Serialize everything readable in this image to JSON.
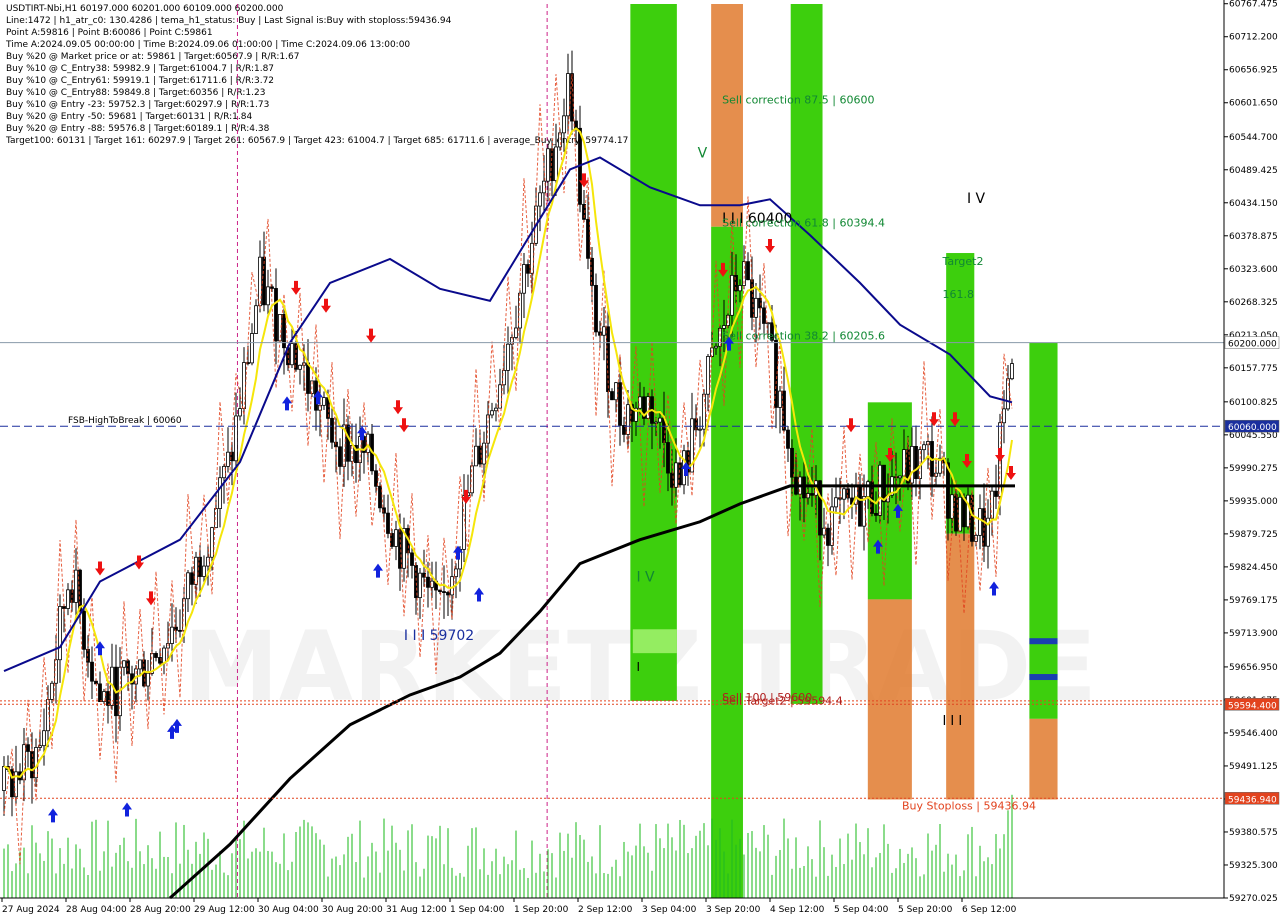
{
  "info_lines": [
    "USDTIRT-Nbi,H1  60197.000 60201.000 60109.000 60200.000",
    "Line:1472  | h1_atr_c0: 130.4286  | tema_h1_status: Buy  | Last Signal is:Buy with stoploss:59436.94",
    "Point A:59816  | Point B:60086  | Point C:59861",
    "Time A:2024.09.05 00:00:00  | Time B:2024.09.06 01:00:00  | Time C:2024.09.06 13:00:00",
    "Buy %20 @ Market price or at: 59861  | Target:60567.9  | R/R:1.67",
    "Buy %10 @ C_Entry38: 59982.9  | Target:61004.7  | R/R:1.87",
    "Buy %10 @ C_Entry61: 59919.1  | Target:61711.6  | R/R:3.72",
    "Buy %10 @ C_Entry88: 59849.8  | Target:60356  | R/R:1.23",
    "Buy %10 @ Entry -23: 59752.3  | Target:60297.9  | R/R:1.73",
    "Buy %20 @ Entry -50: 59681  | Target:60131  | R/R:1.84",
    "Buy %20 @ Entry -88: 59576.8  | Target:60189.1  | R/R:4.38",
    "Target100: 60131  | Target 161: 60297.9  | Target 261: 60567.9  | Target 423: 61004.7  | Target 685: 61711.6  | average_Buy_entry: 59774.17"
  ],
  "watermark": "MARKETZITRADE",
  "colors": {
    "background": "#ffffff",
    "green_zone": "#33cc00",
    "orange_zone": "#e07a2e",
    "tema_line": "#0a0a8c",
    "ma_black": "#000000",
    "yellow_line": "#f5e60a",
    "channel_red": "#e2431e",
    "dashed_blue": "#1a2f9e",
    "volume": "#22bb22",
    "candle": "#000000",
    "buy_arrow": "#1122dd",
    "sell_arrow": "#ee1111"
  },
  "chart_data": {
    "type": "candlestick",
    "symbol": "USDTIRT-Nbi",
    "timeframe": "H1",
    "ylim": [
      59270,
      60767
    ],
    "y_ticks": [
      "60767.475",
      "60712.200",
      "60656.925",
      "60601.650",
      "60544.700",
      "60489.425",
      "60434.150",
      "60378.875",
      "60323.600",
      "60268.325",
      "60213.050",
      "60157.775",
      "60100.825",
      "60045.550",
      "59990.275",
      "59935.000",
      "59879.725",
      "59824.450",
      "59769.175",
      "59713.900",
      "59656.950",
      "59601.675",
      "59546.400",
      "59491.125",
      "59435.850",
      "59380.575",
      "59325.300",
      "59270.025"
    ],
    "x_labels": [
      "27 Aug 2024",
      "28 Aug 04:00",
      "28 Aug 20:00",
      "29 Aug 12:00",
      "30 Aug 04:00",
      "30 Aug 20:00",
      "31 Aug 12:00",
      "1 Sep 04:00",
      "1 Sep 20:00",
      "2 Sep 12:00",
      "3 Sep 04:00",
      "3 Sep 20:00",
      "4 Sep 12:00",
      "5 Sep 04:00",
      "5 Sep 20:00",
      "6 Sep 12:00"
    ],
    "price_labels": [
      {
        "price": 60200.0,
        "text": "60200.000",
        "bg": "#ffffff",
        "fg": "#000000"
      },
      {
        "price": 60060.0,
        "text": "60060.000",
        "bg": "#1a2f9e",
        "fg": "#ffffff"
      },
      {
        "price": 59594.4,
        "text": "59594.400",
        "bg": "#e2431e",
        "fg": "#ffffff"
      },
      {
        "price": 59436.94,
        "text": "59436.940",
        "bg": "#e2431e",
        "fg": "#ffffff"
      }
    ],
    "last_price": 60200.0,
    "reference_lines": [
      {
        "price": 60060,
        "label": "FSB-HighToBreak | 60060",
        "style": "dashed",
        "color": "#1a2f9e"
      },
      {
        "price": 59600,
        "label": "",
        "style": "dotted",
        "color": "#e2431e"
      },
      {
        "price": 59594.4,
        "label": "",
        "style": "dotted",
        "color": "#e2431e"
      },
      {
        "price": 59436.94,
        "label": "Buy Stoploss | 59436.94",
        "style": "dotted",
        "color": "#e2431e"
      }
    ],
    "annotations": [
      {
        "text": "I I I 60400",
        "color": "#000000",
        "x": 0.59,
        "price": 60400,
        "size": 14
      },
      {
        "text": "Sell correction 87.5 | 60600",
        "color": "#118833",
        "x": 0.59,
        "price": 60600,
        "size": 11
      },
      {
        "text": "Sell correction 61.8 | 60394.4",
        "color": "#118833",
        "x": 0.59,
        "price": 60394.4,
        "size": 11
      },
      {
        "text": "Sell correction 38.2 | 60205.6",
        "color": "#118833",
        "x": 0.59,
        "price": 60205.6,
        "size": 11
      },
      {
        "text": "Sell 100 | 59600",
        "color": "#b02020",
        "x": 0.59,
        "price": 59600,
        "size": 11
      },
      {
        "text": "Sell Target2 | 59594.4",
        "color": "#b02020",
        "x": 0.59,
        "price": 59594.4,
        "size": 11
      },
      {
        "text": "I I I 59702",
        "color": "#1a2f9e",
        "x": 0.33,
        "price": 59702,
        "size": 14
      },
      {
        "text": "V",
        "color": "#118833",
        "x": 0.57,
        "price": 60510,
        "size": 14
      },
      {
        "text": "I V",
        "color": "#118833",
        "x": 0.52,
        "price": 59800,
        "size": 14
      },
      {
        "text": "I",
        "color": "#000000",
        "x": 0.52,
        "price": 59650,
        "size": 12
      },
      {
        "text": "I V",
        "color": "#000000",
        "x": 0.79,
        "price": 60434,
        "size": 14
      },
      {
        "text": "I I I",
        "color": "#000000",
        "x": 0.77,
        "price": 59560,
        "size": 13
      },
      {
        "text": "Target2",
        "color": "#118833",
        "x": 0.77,
        "price": 60330,
        "size": 11
      },
      {
        "text": "161.8",
        "color": "#118833",
        "x": 0.77,
        "price": 60275,
        "size": 11
      }
    ],
    "zones": [
      {
        "x0": 0.515,
        "x1": 0.553,
        "y0": 60767,
        "y1": 59600,
        "color": "green"
      },
      {
        "x0": 0.517,
        "x1": 0.553,
        "y0": 59720,
        "y1": 59680,
        "color": "green_light"
      },
      {
        "x0": 0.581,
        "x1": 0.607,
        "y0": 60767,
        "y1": 60394,
        "color": "orange"
      },
      {
        "x0": 0.581,
        "x1": 0.607,
        "y0": 60394,
        "y1": 59270,
        "color": "green"
      },
      {
        "x0": 0.646,
        "x1": 0.672,
        "y0": 60767,
        "y1": 59595,
        "color": "green"
      },
      {
        "x0": 0.709,
        "x1": 0.745,
        "y0": 60100,
        "y1": 59770,
        "color": "green"
      },
      {
        "x0": 0.709,
        "x1": 0.745,
        "y0": 59770,
        "y1": 59435,
        "color": "orange"
      },
      {
        "x0": 0.773,
        "x1": 0.796,
        "y0": 60350,
        "y1": 59880,
        "color": "green"
      },
      {
        "x0": 0.773,
        "x1": 0.796,
        "y0": 59880,
        "y1": 59435,
        "color": "orange"
      },
      {
        "x0": 0.841,
        "x1": 0.864,
        "y0": 60200,
        "y1": 59570,
        "color": "green"
      },
      {
        "x0": 0.841,
        "x1": 0.864,
        "y0": 59570,
        "y1": 59435,
        "color": "orange"
      }
    ],
    "grid": false,
    "legend": "none"
  }
}
